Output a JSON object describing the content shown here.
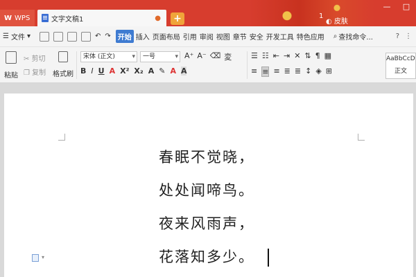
{
  "titlebar": {
    "wps_tab": "WPS",
    "doc_tab": "文字文稿1",
    "close_glyph": "●",
    "add_glyph": "+",
    "badge": "1",
    "skin": "皮肤",
    "minimize": "—",
    "maximize": "□"
  },
  "menubar": {
    "file": "文件",
    "file_chevron": "▾",
    "tabs": [
      "开始",
      "插入",
      "页面布局",
      "引用",
      "审阅",
      "视图",
      "章节",
      "安全",
      "开发工具",
      "特色应用"
    ],
    "search": "查找命令...",
    "help": "?",
    "more": "⋮"
  },
  "toolbar": {
    "paste": "粘贴",
    "cut": "剪切",
    "copy": "复制",
    "format_painter": "格式刷",
    "font_name": "宋体 (正文)",
    "font_size": "一号",
    "style_preview": "AaBbCcDd",
    "style_name": "正文"
  },
  "document": {
    "lines": [
      "春眠不觉晓，",
      "处处闻啼鸟。",
      "夜来风雨声，",
      "花落知多少。"
    ]
  },
  "colors": {
    "titlebar": "#d73d2e",
    "accent": "#3e7bd1"
  }
}
